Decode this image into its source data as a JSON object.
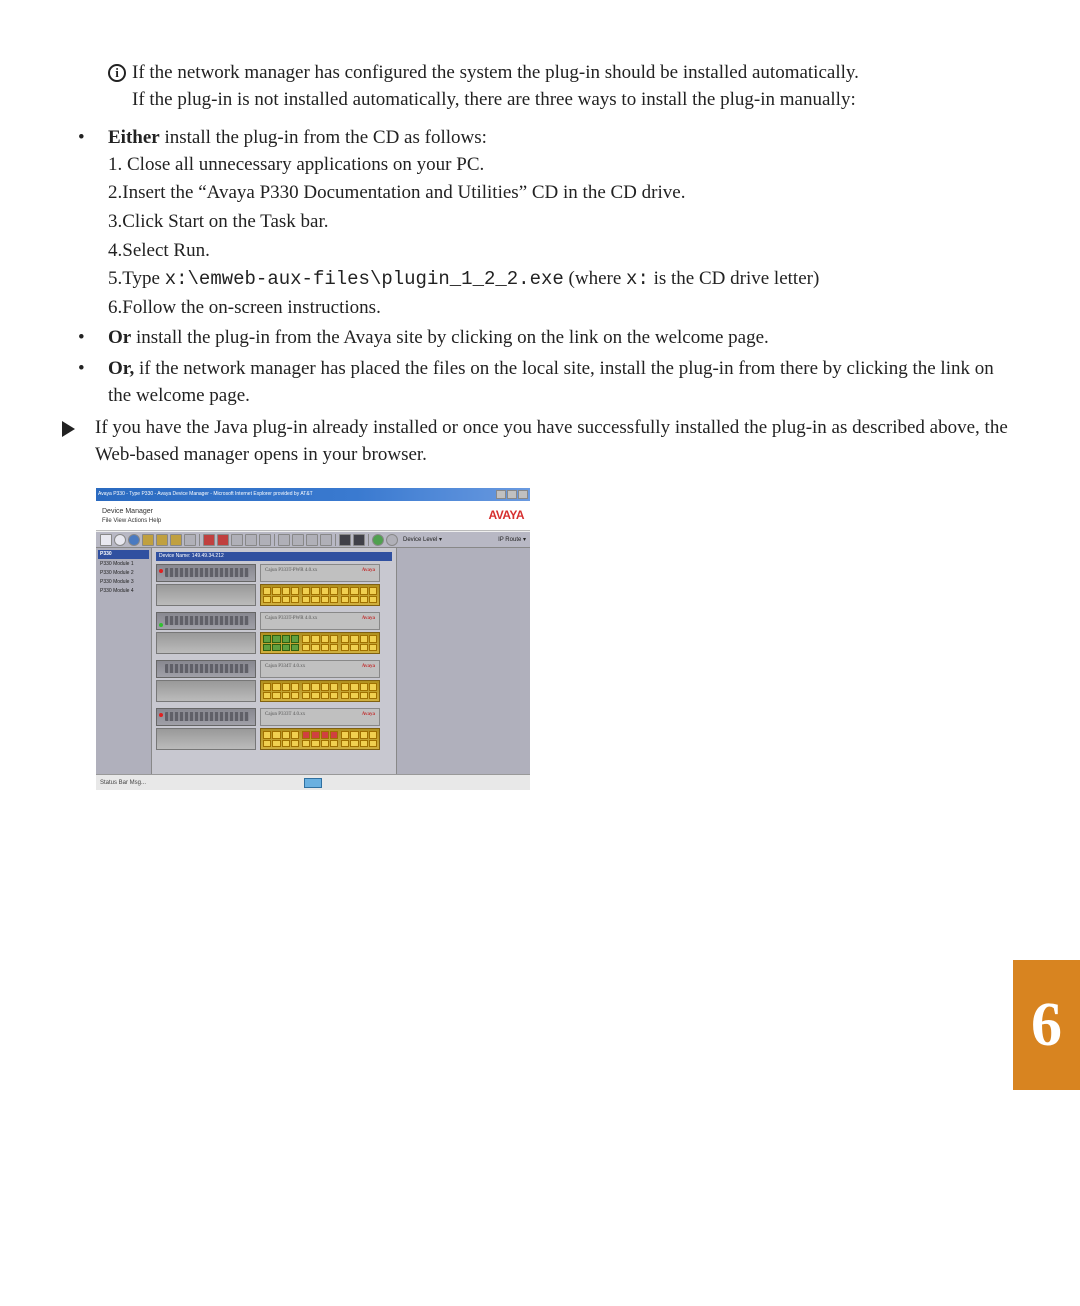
{
  "info": {
    "line1": "If the network manager has configured the system the plug-in should be installed automatically.",
    "line2": "If the plug-in is not installed automatically,  there are three ways to install the plug-in manually:"
  },
  "bullets": {
    "b1_lead": "Either",
    "b1_rest": " install the plug-in from the CD as follows:",
    "steps": {
      "s1": "1.   Close all unnecessary applications on your PC.",
      "s2": "2.Insert the “Avaya P330 Documentation and Utilities” CD in the CD drive.",
      "s3": "3.Click Start on the Task bar.",
      "s4": "4.Select Run.",
      "s5a": "5.Type ",
      "s5_code": "x:\\emweb-aux-files\\plugin_1_2_2.exe",
      "s5b": " (where ",
      "s5_code2": "x:",
      "s5c": " is the CD drive letter)",
      "s6": "6.Follow the on-screen instructions."
    },
    "b2_lead": "Or",
    "b2_rest": " install the plug-in from the Avaya site by clicking on the link on the welcome page.",
    "b3_lead": "Or,",
    "b3_rest": " if the network manager has placed the files on the local site, install the plug-in from there by clicking the link on the welcome page."
  },
  "arrow": {
    "text": "If you have the Java plug-in already installed or once you have successfully installed the plug-in as described above, the Web-based manager opens in your browser."
  },
  "screenshot": {
    "titlebar": "Avaya P330 - Type P330 - Avaya Device Manager - Microsoft Internet Explorer provided by AT&T",
    "app_title": "Device Manager",
    "menu": "File   View   Actions   Help",
    "logo": "AVAYA",
    "toolbar_mode": "Device Level ▾",
    "toolbar_right": "IP Route ▾",
    "tree_title": "P330",
    "tree_items": [
      "P330 Module 1",
      "P330 Module 2",
      "P330 Module 3",
      "P330 Module 4"
    ],
    "main_title": "Device Name: 149.49.34.212",
    "module_labels": [
      "Cajun P333T-PWR 4.0.xx",
      "Cajun P333T-PWR 4.0.xx",
      "Cajun P334T 4.0.xx",
      "Cajun P333T 4.0.xx"
    ],
    "module_brand": "Avaya",
    "status": "Status Bar Msg..."
  },
  "chapter": "6"
}
